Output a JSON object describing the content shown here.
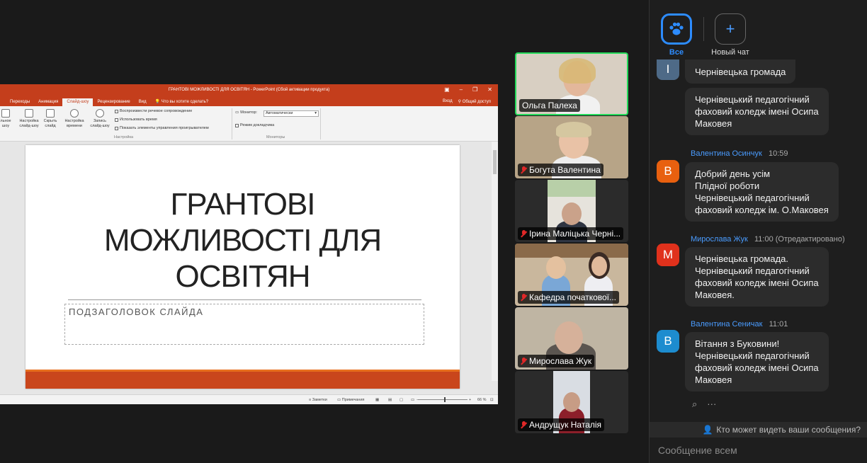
{
  "ppt": {
    "window_title": "ГРАНТОВІ МОЖЛИВОСТІ ДЛЯ ОСВІТЯН - PowerPoint (Сбой активации продукта)",
    "tabs": [
      "Переходы",
      "Анимация",
      "Слайд-шоу",
      "Рецензирование",
      "Вид"
    ],
    "active_tab": "Слайд-шоу",
    "tellme": "Что вы хотите сделать?",
    "signin": "Вход",
    "share": "Общий доступ",
    "ribbon": {
      "btn_custom": "льное\nшоу",
      "btn_setup": "Настройка\nслайд-шоу",
      "btn_hide": "Скрыть\nслайд",
      "btn_rehearse": "Настройка\nвремени",
      "btn_record": "Запись\nслайд-шоу",
      "chk_narration": "Воспроизвести речевое сопровождение",
      "chk_timings": "Использовать время",
      "chk_controls": "Показать элементы управления проигрывателем",
      "group_setup": "Настройка",
      "monitor_label": "Монитор:",
      "monitor_value": "Автоматически",
      "chk_presenter": "Режим докладчика",
      "group_monitors": "Мониторы"
    },
    "slide": {
      "title": "ГРАНТОВІ\nМОЖЛИВОСТІ ДЛЯ\nОСВІТЯН",
      "subtitle": "ПОДЗАГОЛОВОК СЛАЙДА"
    },
    "status": {
      "notes": "Заметки",
      "comments": "Примечания",
      "zoom": "66 %"
    }
  },
  "participants": [
    {
      "name": "Ольга Палеха",
      "muted": false
    },
    {
      "name": "Богута Валентина",
      "muted": true
    },
    {
      "name": "Ірина Маліцька Черні...",
      "muted": true
    },
    {
      "name": "Кафедра початкової...",
      "muted": true
    },
    {
      "name": "Мирослава Жук",
      "muted": true
    },
    {
      "name": "Андрущук Наталія",
      "muted": true
    }
  ],
  "chat": {
    "all_label": "Все",
    "new_chat_label": "Новый чат",
    "messages": [
      {
        "text": "Чернівецька громада",
        "avatar": "І",
        "avatar_color": "#4e6a87"
      },
      {
        "text": "Чернівецький педагогічний\nфаховий коледж імені Осипа\nМаковея"
      },
      {
        "sender": "Валентина Осинчук",
        "time": "10:59",
        "avatar": "В",
        "avatar_color": "#e8600f",
        "text": "Добрий  день усім\nПлідної роботи\nЧернівецький педагогічний\nфаховий коледж ім. О.Маковея"
      },
      {
        "sender": "Мирослава Жук",
        "time": "11:00 (Отредактировано)",
        "avatar": "М",
        "avatar_color": "#e0311c",
        "text": "Чернівецька громада.\nЧернівецький педагогічний\nфаховий коледж імені Осипа\nМаковея."
      },
      {
        "sender": "Валентина Сеничак",
        "time": "11:01",
        "avatar": "В",
        "avatar_color": "#1d8ccf",
        "text": "Вітання з Буковини!\nЧернівецький педагогічний\nфаховий коледж імені Осипа\nМаковея"
      }
    ],
    "visibility_text": "Кто может видеть ваши сообщения?",
    "compose_placeholder": "Сообщение всем",
    "more": "···"
  }
}
